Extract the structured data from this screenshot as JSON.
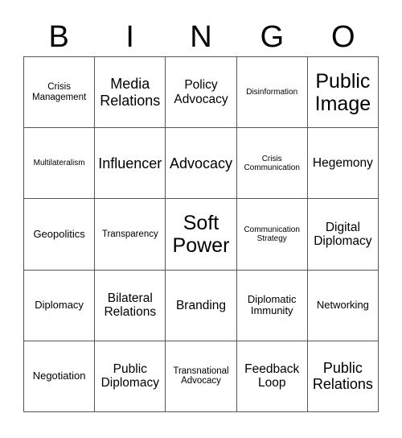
{
  "card": {
    "title_letters": [
      "B",
      "I",
      "N",
      "G",
      "O"
    ],
    "columns": 5,
    "rows": 5,
    "border_color": "#555555",
    "text_color": "#000000",
    "background_color": "#ffffff"
  },
  "cells": [
    {
      "text": "Crisis Management",
      "size": "fs-sm"
    },
    {
      "text": "Media Relations",
      "size": "fs-xl"
    },
    {
      "text": "Policy Advocacy",
      "size": "fs-lg"
    },
    {
      "text": "Disinformation",
      "size": "fs-xs"
    },
    {
      "text": "Public Image",
      "size": "fs-xxl"
    },
    {
      "text": "Multilateralism",
      "size": "fs-xs"
    },
    {
      "text": "Influencer",
      "size": "fs-xl"
    },
    {
      "text": "Advocacy",
      "size": "fs-xl"
    },
    {
      "text": "Crisis Communication",
      "size": "fs-xs"
    },
    {
      "text": "Hegemony",
      "size": "fs-lg"
    },
    {
      "text": "Geopolitics",
      "size": "fs-md"
    },
    {
      "text": "Transparency",
      "size": "fs-sm"
    },
    {
      "text": "Soft Power",
      "size": "fs-xxl"
    },
    {
      "text": "Communication Strategy",
      "size": "fs-xs"
    },
    {
      "text": "Digital Diplomacy",
      "size": "fs-lg"
    },
    {
      "text": "Diplomacy",
      "size": "fs-md"
    },
    {
      "text": "Bilateral Relations",
      "size": "fs-lg"
    },
    {
      "text": "Branding",
      "size": "fs-lg"
    },
    {
      "text": "Diplomatic Immunity",
      "size": "fs-md"
    },
    {
      "text": "Networking",
      "size": "fs-md"
    },
    {
      "text": "Negotiation",
      "size": "fs-md"
    },
    {
      "text": "Public Diplomacy",
      "size": "fs-lg"
    },
    {
      "text": "Transnational Advocacy",
      "size": "fs-sm"
    },
    {
      "text": "Feedback Loop",
      "size": "fs-lg"
    },
    {
      "text": "Public Relations",
      "size": "fs-xl"
    }
  ]
}
